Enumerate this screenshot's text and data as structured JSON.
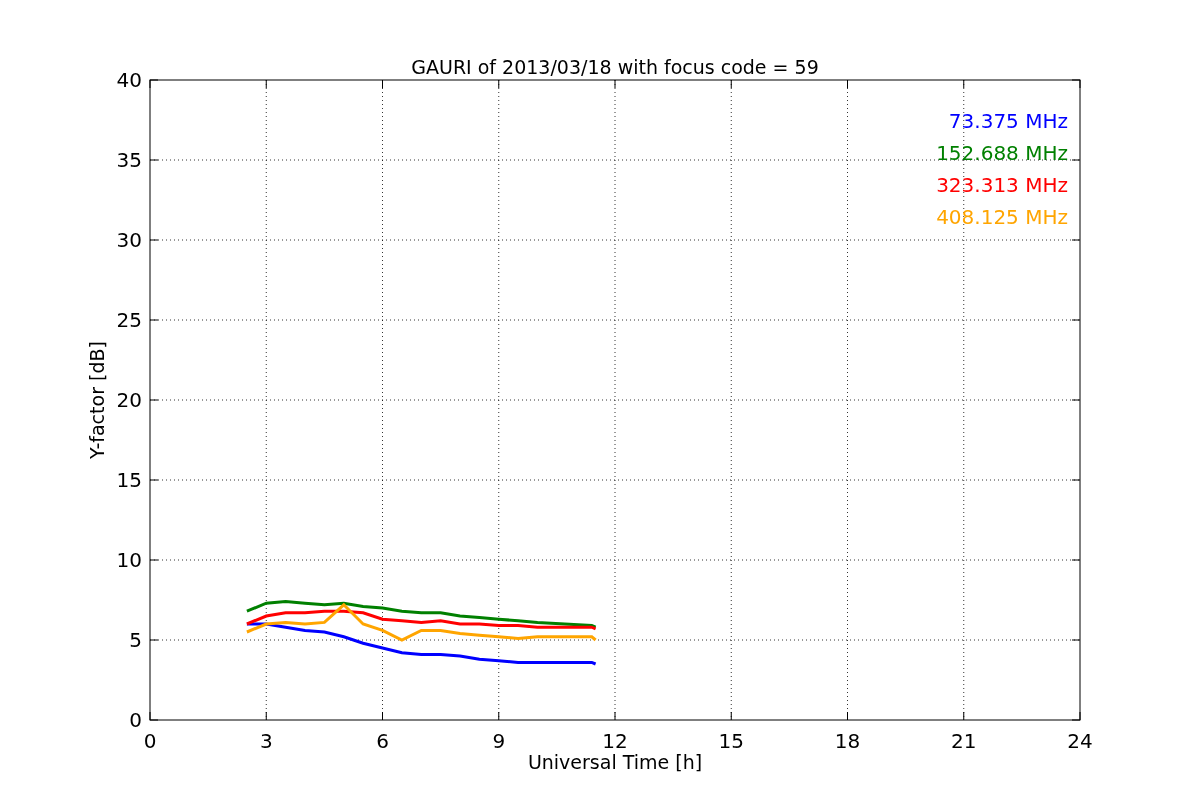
{
  "figure": {
    "chart_data": {
      "type": "line",
      "title": "GAURI of 2013/03/18 with focus code = 59",
      "xlabel": "Universal Time [h]",
      "ylabel": "Y-factor [dB]",
      "x": [
        2.5,
        3,
        3.5,
        4,
        4.5,
        5,
        5.5,
        6,
        6.5,
        7,
        7.5,
        8,
        8.5,
        9,
        9.5,
        10,
        11.4,
        11.5
      ],
      "series": [
        {
          "name": "73.375 MHz",
          "color": "#0000ff",
          "values": [
            6.0,
            6.0,
            5.8,
            5.6,
            5.5,
            5.2,
            4.8,
            4.5,
            4.2,
            4.1,
            4.1,
            4.0,
            3.8,
            3.7,
            3.6,
            3.6,
            3.6,
            3.5
          ]
        },
        {
          "name": "152.688 MHz",
          "color": "#008000",
          "values": [
            6.8,
            7.3,
            7.4,
            7.3,
            7.2,
            7.3,
            7.1,
            7.0,
            6.8,
            6.7,
            6.7,
            6.5,
            6.4,
            6.3,
            6.2,
            6.1,
            5.9,
            5.8
          ]
        },
        {
          "name": "323.313 MHz",
          "color": "#ff0000",
          "values": [
            6.0,
            6.5,
            6.7,
            6.7,
            6.8,
            6.8,
            6.7,
            6.3,
            6.2,
            6.1,
            6.2,
            6.0,
            6.0,
            5.9,
            5.9,
            5.8,
            5.8,
            5.7
          ]
        },
        {
          "name": "408.125 MHz",
          "color": "#ffa500",
          "values": [
            5.5,
            6.0,
            6.1,
            6.0,
            6.1,
            7.2,
            6.0,
            5.6,
            5.0,
            5.6,
            5.6,
            5.4,
            5.3,
            5.2,
            5.1,
            5.2,
            5.2,
            5.0
          ]
        }
      ],
      "xlim": [
        0,
        24
      ],
      "ylim": [
        0,
        40
      ],
      "xticks": [
        0,
        3,
        6,
        9,
        12,
        15,
        18,
        21,
        24
      ],
      "yticks": [
        0,
        5,
        10,
        15,
        20,
        25,
        30,
        35,
        40
      ],
      "grid": true
    }
  }
}
